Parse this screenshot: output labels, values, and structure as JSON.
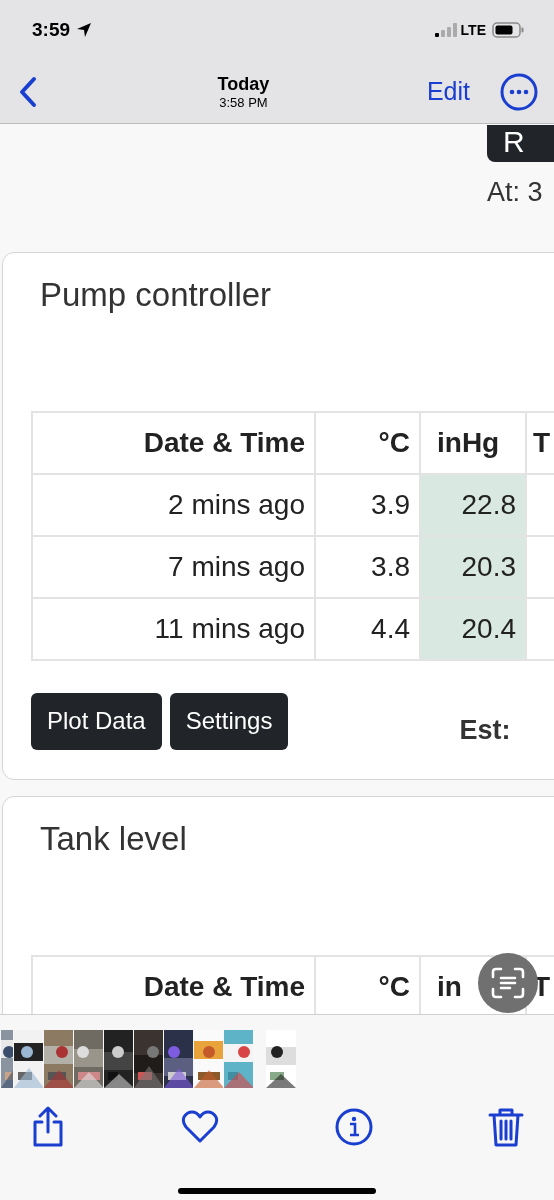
{
  "status_bar": {
    "time": "3:59",
    "network": "LTE"
  },
  "nav_bar": {
    "title": "Today",
    "subtitle": "3:58 PM",
    "edit": "Edit"
  },
  "page": {
    "button": "R",
    "at_text": "At: 3"
  },
  "cards": [
    {
      "title": "Pump controller",
      "columns": [
        {
          "label": "Date & Time",
          "highlighted": false
        },
        {
          "label": "°C",
          "highlighted": false
        },
        {
          "label": "inHg",
          "highlighted": true
        },
        {
          "label": "T",
          "highlighted": false
        }
      ],
      "rows": [
        [
          "2 mins ago",
          "3.9",
          "22.8"
        ],
        [
          "7 mins ago",
          "3.8",
          "20.3"
        ],
        [
          "11 mins ago",
          "4.4",
          "20.4"
        ]
      ],
      "buttons": [
        "Plot Data",
        "Settings"
      ],
      "est": "Est:"
    },
    {
      "title": "Tank level",
      "columns": [
        {
          "label": "Date & Time"
        },
        {
          "label": "°C"
        },
        {
          "label": "in"
        },
        {
          "label": "T"
        }
      ]
    }
  ],
  "thumbnails": [
    {
      "kind": "picture",
      "selected": false
    },
    {
      "kind": "picture",
      "selected": false
    },
    {
      "kind": "picture",
      "selected": false
    },
    {
      "kind": "picture",
      "selected": false
    },
    {
      "kind": "picture",
      "selected": false
    },
    {
      "kind": "picture",
      "selected": false
    },
    {
      "kind": "picture",
      "selected": false
    },
    {
      "kind": "picture",
      "selected": false
    },
    {
      "kind": "picture",
      "selected": false
    },
    {
      "kind": "picture",
      "selected": true
    }
  ]
}
